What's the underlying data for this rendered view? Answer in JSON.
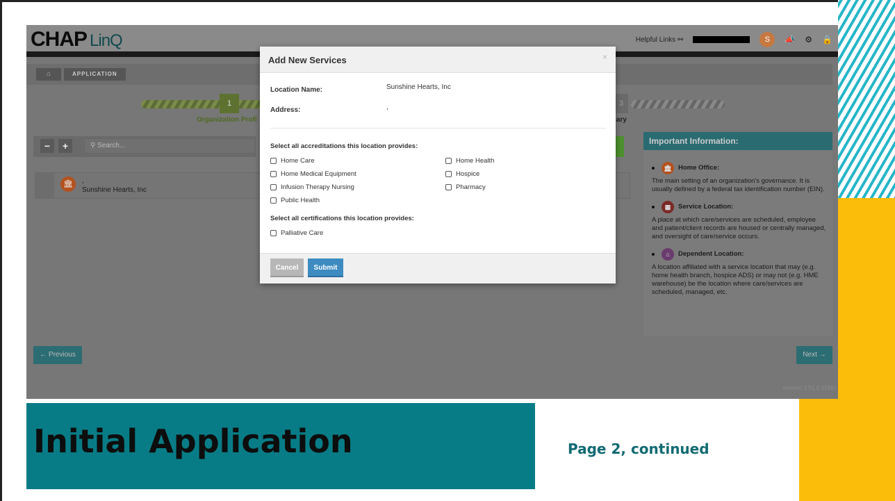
{
  "app": {
    "logo_main": "CHAP",
    "logo_sub": "LinQ",
    "helpful_links": "Helpful Links",
    "avatar_initial": "S",
    "breadcrumb": "APPLICATION",
    "step1_number": "1",
    "step1_label": "Organization Profi",
    "step3_number": "3",
    "step3_label": "mary",
    "search_placeholder": "Search...",
    "location_line1": ",",
    "location_name": "Sunshine Hearts, Inc",
    "previous_label": "← Previous",
    "next_label": "Next →",
    "version": "Version: 1.51.0.21960"
  },
  "side_panel": {
    "title": "Important Information:",
    "items": [
      {
        "title": "Home Office:",
        "text": "The main setting of an organization's governance. It is usually defined by a federal tax identification number (EIN).",
        "color": "#b3521f"
      },
      {
        "title": "Service Location:",
        "text": "A place at which care/services are scheduled, employee and patient/client records are housed or centrally managed, and oversight of care/service occurs.",
        "color": "#7a2a26"
      },
      {
        "title": "Dependent Location:",
        "text": "A location affiliated with a service location that may (e.g. home health branch, hospice ADS) or may not (e.g. HME warehouse) be the location where care/services are scheduled, managed, etc.",
        "color": "#6a3b6e"
      }
    ]
  },
  "modal": {
    "title": "Add New Services",
    "close": "×",
    "location_name_label": "Location Name:",
    "location_name_value": "Sunshine Hearts, Inc",
    "address_label": "Address:",
    "address_value": ",",
    "accreditations_label": "Select all accreditations this location provides:",
    "accreditations": [
      "Home Care",
      "Home Health",
      "Home Medical Equipment",
      "Hospice",
      "Infusion Therapy Nursing",
      "Pharmacy",
      "Public Health"
    ],
    "certifications_label": "Select all certifications this location provides:",
    "certifications": [
      "Palliative Care"
    ],
    "cancel": "Cancel",
    "submit": "Submit"
  },
  "slide": {
    "title": "Initial Application",
    "subtitle": "Page 2, continued"
  }
}
